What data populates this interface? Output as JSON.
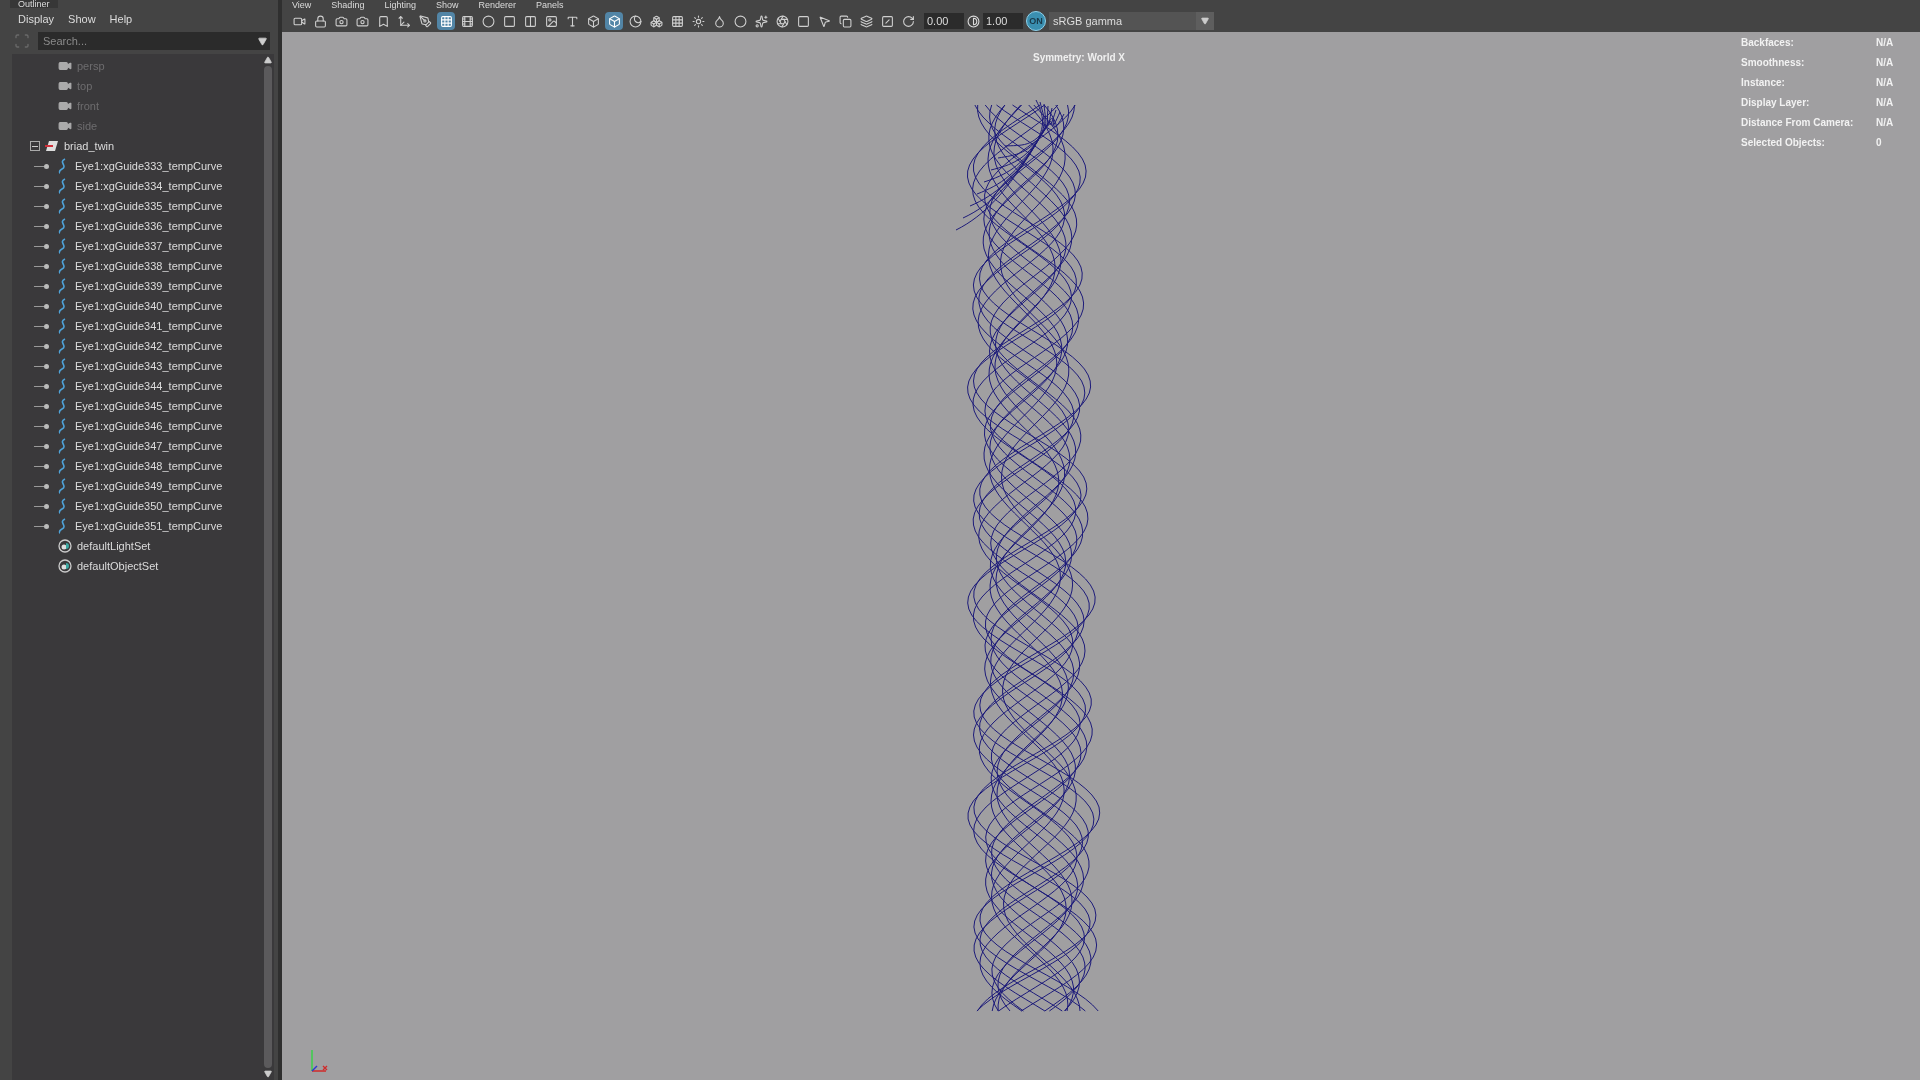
{
  "outliner": {
    "tab": "Outliner",
    "menus": [
      "Display",
      "Show",
      "Help"
    ],
    "search": {
      "placeholder": "Search..."
    },
    "items": [
      {
        "kind": "camera",
        "label": "persp",
        "dimmed": true
      },
      {
        "kind": "camera",
        "label": "top",
        "dimmed": true
      },
      {
        "kind": "camera",
        "label": "front",
        "dimmed": true
      },
      {
        "kind": "camera",
        "label": "side",
        "dimmed": true
      },
      {
        "kind": "group",
        "label": "briad_twin",
        "expanded": true,
        "children": [
          {
            "kind": "curve",
            "label": "Eye1:xgGuide333_tempCurve"
          },
          {
            "kind": "curve",
            "label": "Eye1:xgGuide334_tempCurve"
          },
          {
            "kind": "curve",
            "label": "Eye1:xgGuide335_tempCurve"
          },
          {
            "kind": "curve",
            "label": "Eye1:xgGuide336_tempCurve"
          },
          {
            "kind": "curve",
            "label": "Eye1:xgGuide337_tempCurve"
          },
          {
            "kind": "curve",
            "label": "Eye1:xgGuide338_tempCurve"
          },
          {
            "kind": "curve",
            "label": "Eye1:xgGuide339_tempCurve"
          },
          {
            "kind": "curve",
            "label": "Eye1:xgGuide340_tempCurve"
          },
          {
            "kind": "curve",
            "label": "Eye1:xgGuide341_tempCurve"
          },
          {
            "kind": "curve",
            "label": "Eye1:xgGuide342_tempCurve"
          },
          {
            "kind": "curve",
            "label": "Eye1:xgGuide343_tempCurve"
          },
          {
            "kind": "curve",
            "label": "Eye1:xgGuide344_tempCurve"
          },
          {
            "kind": "curve",
            "label": "Eye1:xgGuide345_tempCurve"
          },
          {
            "kind": "curve",
            "label": "Eye1:xgGuide346_tempCurve"
          },
          {
            "kind": "curve",
            "label": "Eye1:xgGuide347_tempCurve"
          },
          {
            "kind": "curve",
            "label": "Eye1:xgGuide348_tempCurve"
          },
          {
            "kind": "curve",
            "label": "Eye1:xgGuide349_tempCurve"
          },
          {
            "kind": "curve",
            "label": "Eye1:xgGuide350_tempCurve"
          },
          {
            "kind": "curve",
            "label": "Eye1:xgGuide351_tempCurve"
          }
        ]
      },
      {
        "kind": "set",
        "label": "defaultLightSet"
      },
      {
        "kind": "set",
        "label": "defaultObjectSet"
      }
    ]
  },
  "viewport": {
    "menus": [
      "View",
      "Shading",
      "Lighting",
      "Show",
      "Renderer",
      "Panels"
    ],
    "toolbar": [
      {
        "selected": false
      },
      {
        "selected": false
      },
      {
        "selected": false
      },
      {
        "selected": false
      },
      {
        "selected": false
      },
      {
        "selected": false
      },
      {
        "selected": false
      },
      {
        "selected": true
      },
      {
        "selected": false
      },
      {
        "selected": false
      },
      {
        "selected": false
      },
      {
        "selected": false
      },
      {
        "selected": false
      },
      {
        "selected": false
      },
      {
        "selected": false
      },
      {
        "selected": true
      },
      {
        "selected": false
      },
      {
        "selected": false
      },
      {
        "selected": false
      },
      {
        "selected": false
      },
      {
        "selected": false
      },
      {
        "selected": false
      },
      {
        "selected": false
      },
      {
        "selected": false
      },
      {
        "selected": false
      },
      {
        "selected": false
      },
      {
        "selected": false
      },
      {
        "selected": false
      },
      {
        "selected": false
      },
      {
        "selected": false
      }
    ],
    "exposure": "0.00",
    "gamma": "1.00",
    "color_management": {
      "label": "ON",
      "on": true
    },
    "view_transform": "sRGB gamma",
    "symmetry": "Symmetry: World X",
    "hud": [
      {
        "label": "Backfaces:",
        "value": "N/A"
      },
      {
        "label": "Smoothness:",
        "value": "N/A"
      },
      {
        "label": "Instance:",
        "value": "N/A"
      },
      {
        "label": "Display Layer:",
        "value": "N/A"
      },
      {
        "label": "Distance From Camera:",
        "value": "N/A"
      },
      {
        "label": "Selected Objects:",
        "value": "0"
      }
    ]
  }
}
